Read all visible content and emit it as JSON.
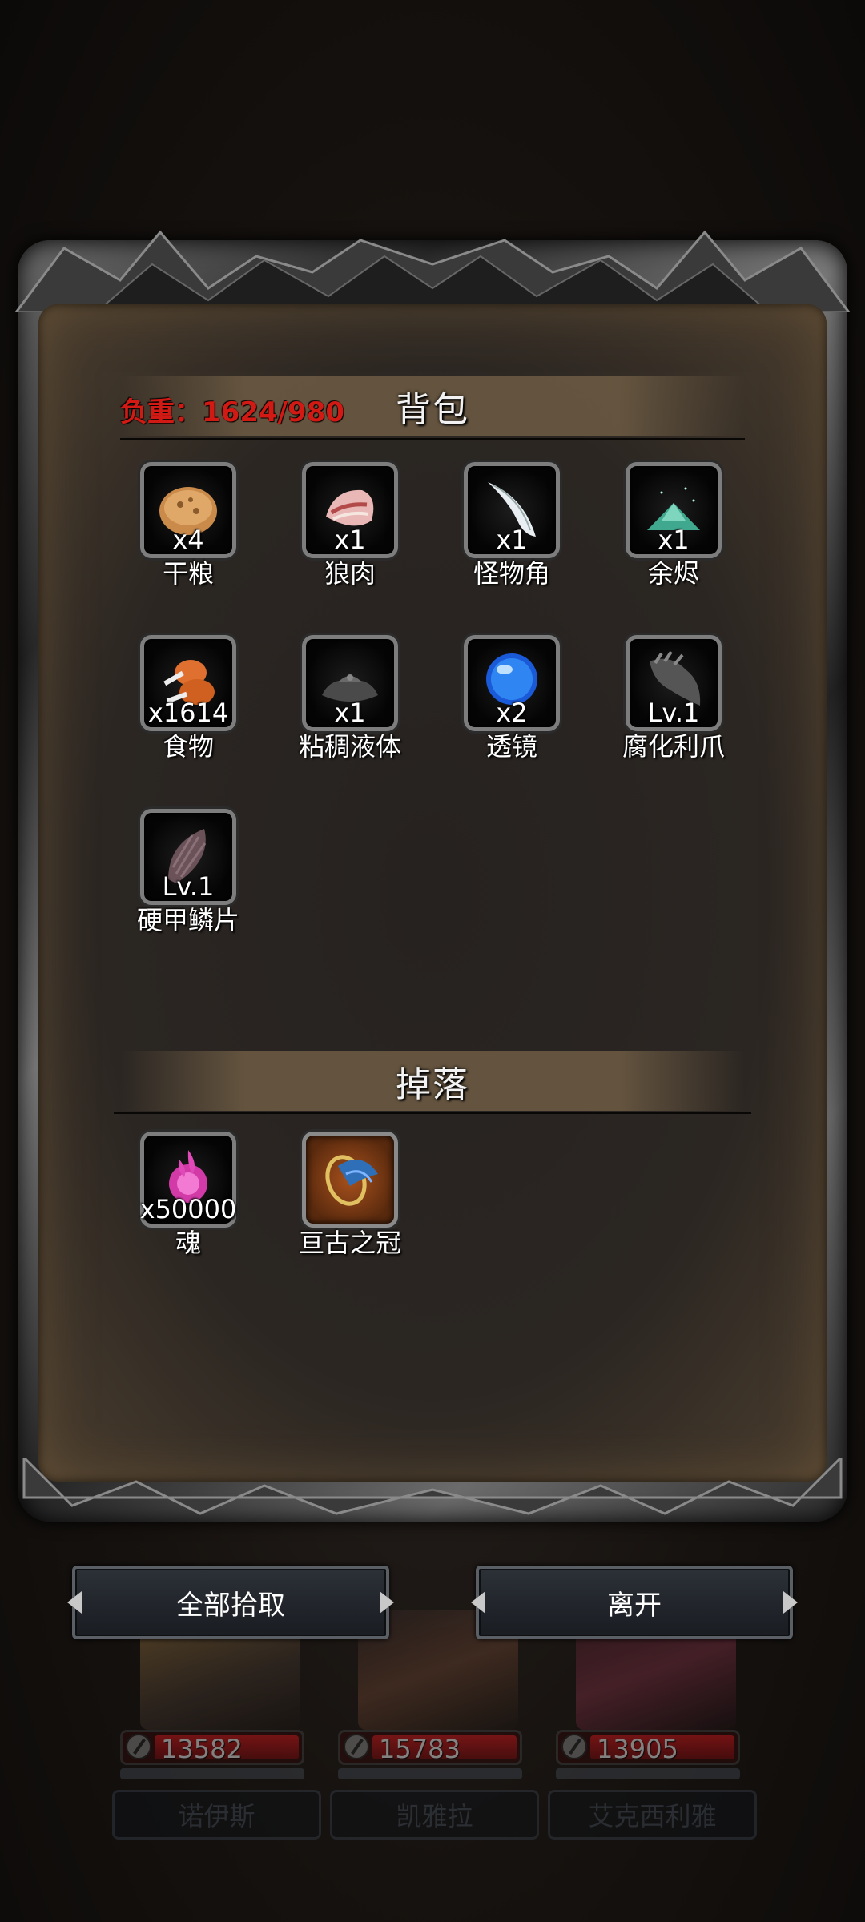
{
  "backpack": {
    "title": "背包",
    "weight": "负重：1624/980",
    "items": [
      {
        "qty": "x4",
        "name": "干粮",
        "icon": "dry-ration-icon"
      },
      {
        "qty": "x1",
        "name": "狼肉",
        "icon": "wolf-meat-icon"
      },
      {
        "qty": "x1",
        "name": "怪物角",
        "icon": "monster-horn-icon"
      },
      {
        "qty": "x1",
        "name": "余烬",
        "icon": "ember-icon"
      },
      {
        "qty": "x1614",
        "name": "食物",
        "icon": "food-icon"
      },
      {
        "qty": "x1",
        "name": "粘稠液体",
        "icon": "viscous-liquid-icon"
      },
      {
        "qty": "x2",
        "name": "透镜",
        "icon": "lens-icon"
      },
      {
        "qty": "Lv.1",
        "name": "腐化利爪",
        "icon": "corrupted-claw-icon"
      },
      {
        "qty": "Lv.1",
        "name": "硬甲鳞片",
        "icon": "hard-scale-icon"
      }
    ]
  },
  "drops": {
    "title": "掉落",
    "items": [
      {
        "qty": "x50000",
        "name": "魂",
        "icon": "soul-icon"
      },
      {
        "qty": "",
        "name": "亘古之冠",
        "icon": "ancient-crown-icon"
      }
    ]
  },
  "buttons": {
    "pickup_all": "全部拾取",
    "leave": "离开"
  },
  "heroes": [
    {
      "hp": "13582",
      "name": "诺伊斯"
    },
    {
      "hp": "15783",
      "name": "凯雅拉"
    },
    {
      "hp": "13905",
      "name": "艾克西利雅"
    }
  ],
  "colors": {
    "weight_text": "#d21a14",
    "hp_bar": "#c0151a",
    "crown_slot": "#a6501c"
  }
}
